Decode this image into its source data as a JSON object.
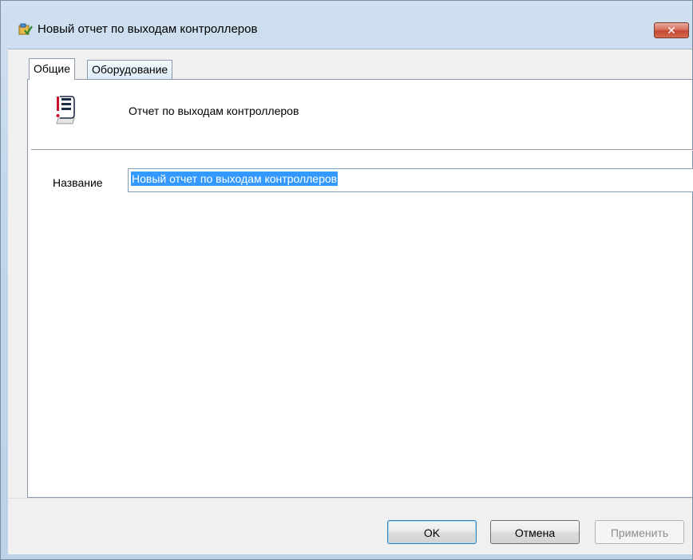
{
  "window": {
    "title": "Новый отчет по выходам контроллеров",
    "close_label": "✕",
    "app_icon": "report-properties-icon"
  },
  "tabs": [
    {
      "label": "Общие",
      "active": true
    },
    {
      "label": "Оборудование",
      "active": false
    }
  ],
  "general": {
    "report_icon": "report-list-icon",
    "report_type": "Отчет по выходам контроллеров",
    "name_label": "Название",
    "name_value": "Новый отчет по выходам контроллеров"
  },
  "buttons": {
    "ok": "OK",
    "cancel": "Отмена",
    "apply": "Применить"
  },
  "colors": {
    "accent_red": "#c8102e",
    "selection": "#3399ff",
    "close_button": "#c24a33"
  }
}
